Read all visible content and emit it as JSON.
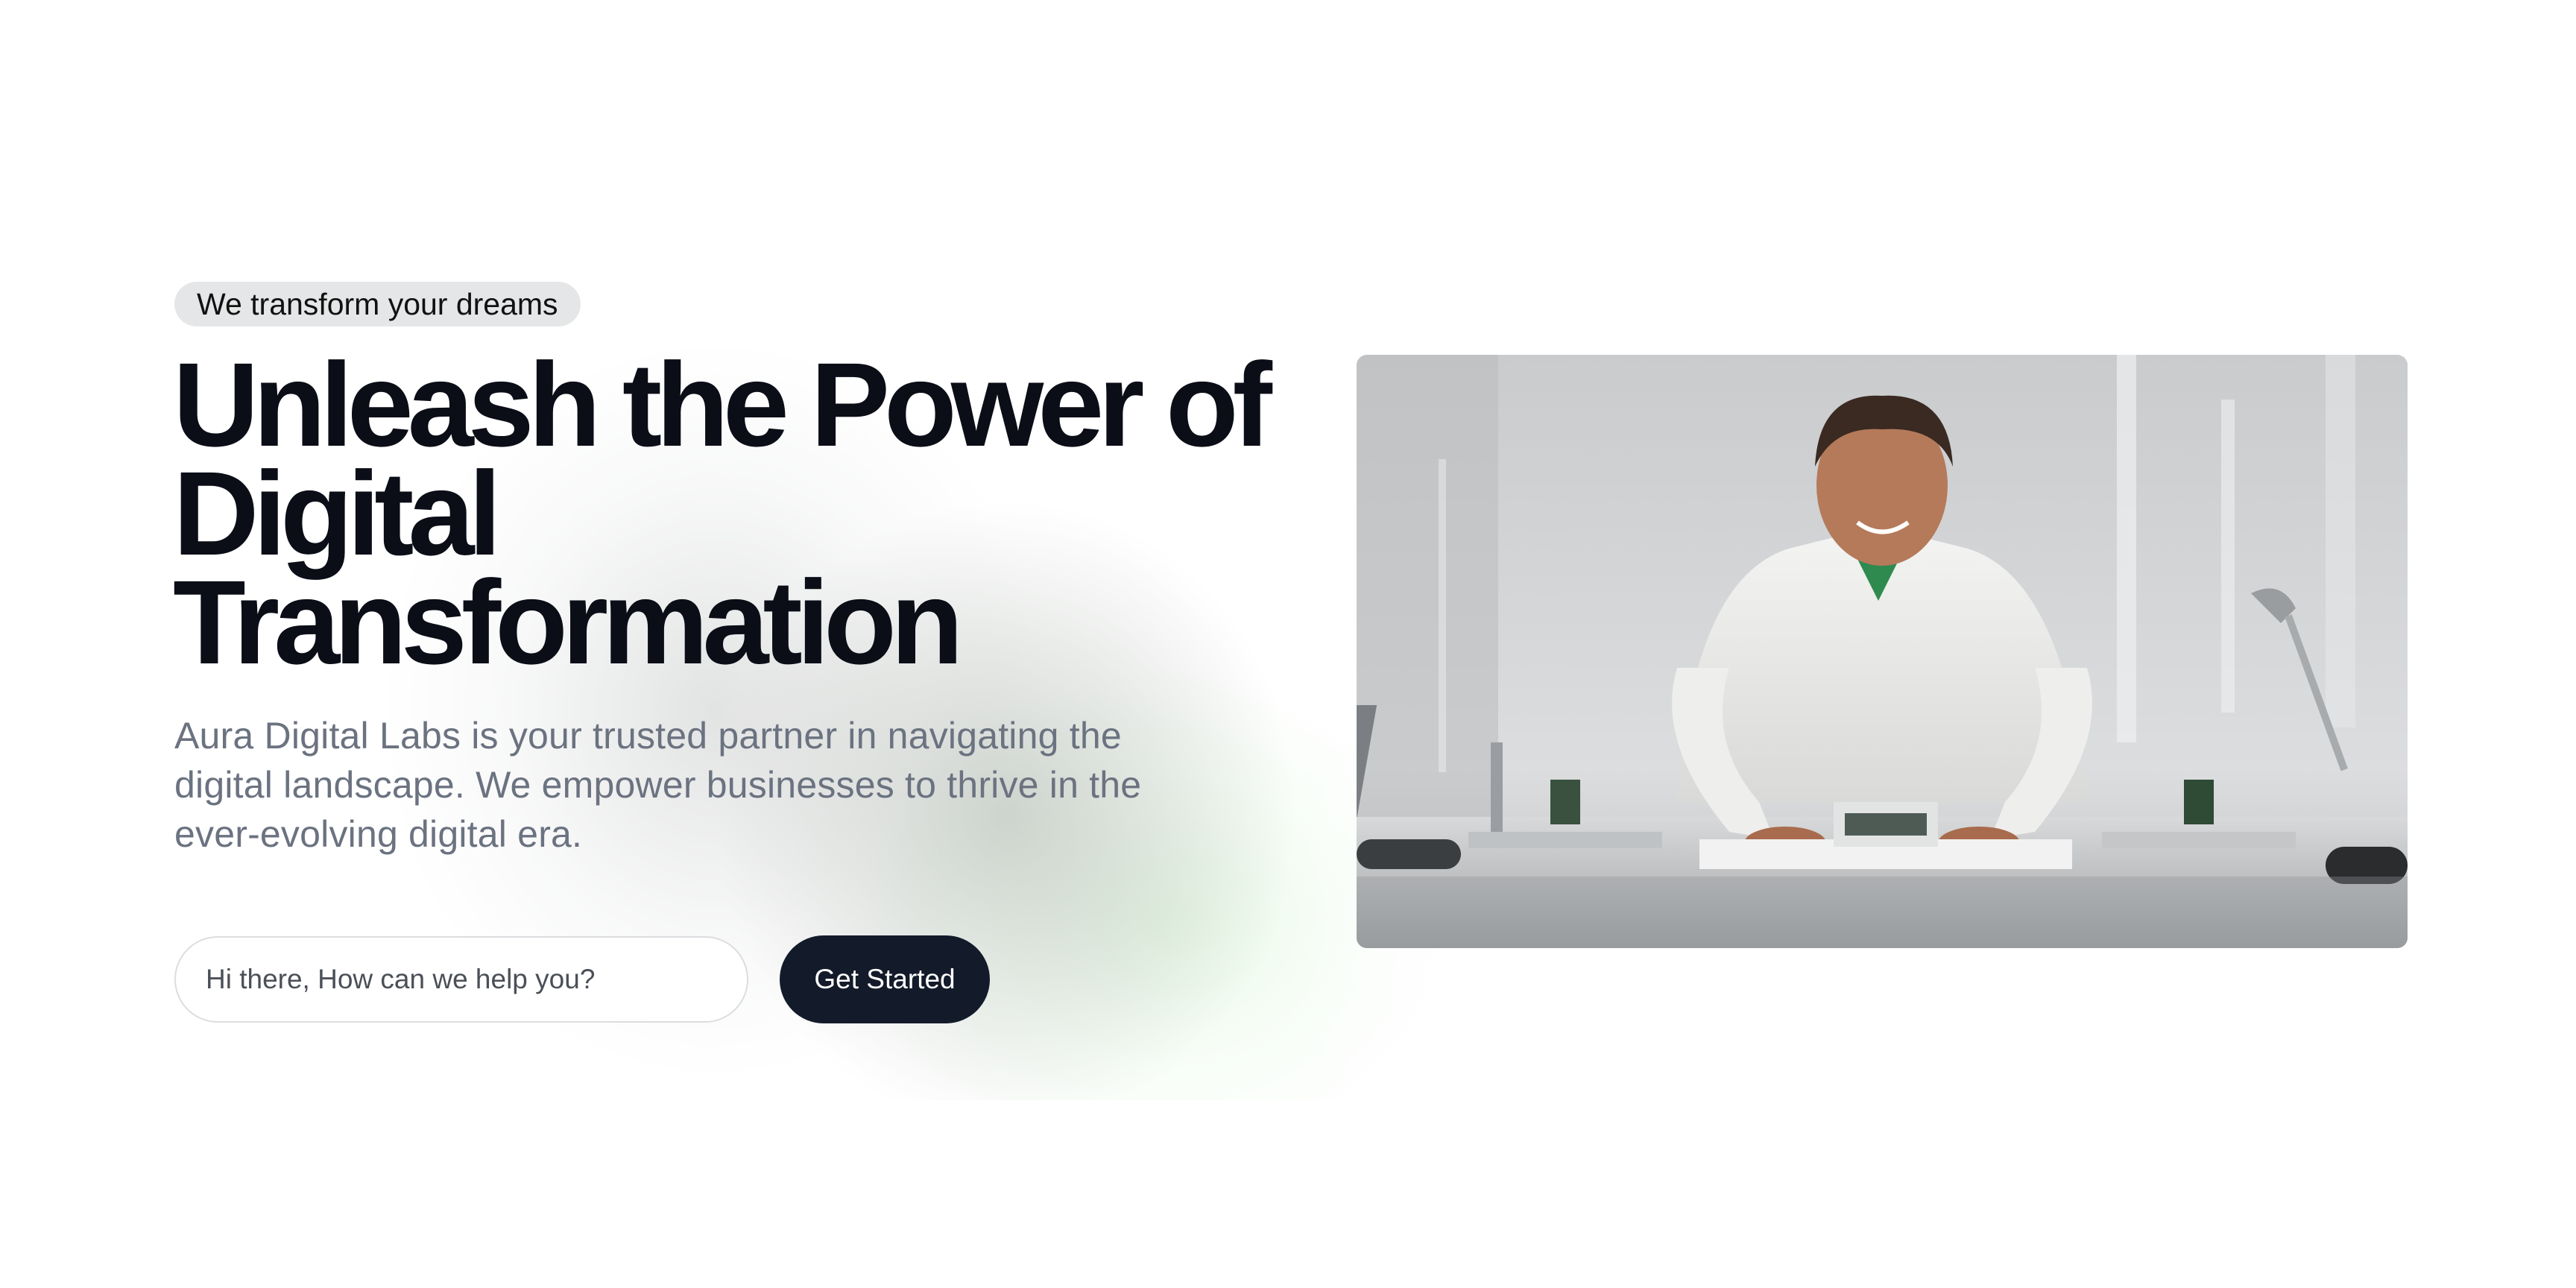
{
  "hero": {
    "badge": "We transform your dreams",
    "headline_lines": [
      "Unleash the Power of",
      "Digital",
      "Transformation"
    ],
    "description": "Aura Digital Labs is your trusted partner in navigating the digital landscape. We empower businesses to thrive in the ever-evolving digital era.",
    "input": {
      "placeholder": "Hi there, How can we help you?",
      "value": ""
    },
    "cta_label": "Get Started",
    "image": {
      "subject": "smiling young man at desk with electronics"
    }
  },
  "colors": {
    "headline": "#0b0d17",
    "body_text": "#6b7280",
    "button_bg": "#131a2a",
    "badge_bg": "#e5e6e7",
    "accent_glow": "#d7f5d2"
  }
}
